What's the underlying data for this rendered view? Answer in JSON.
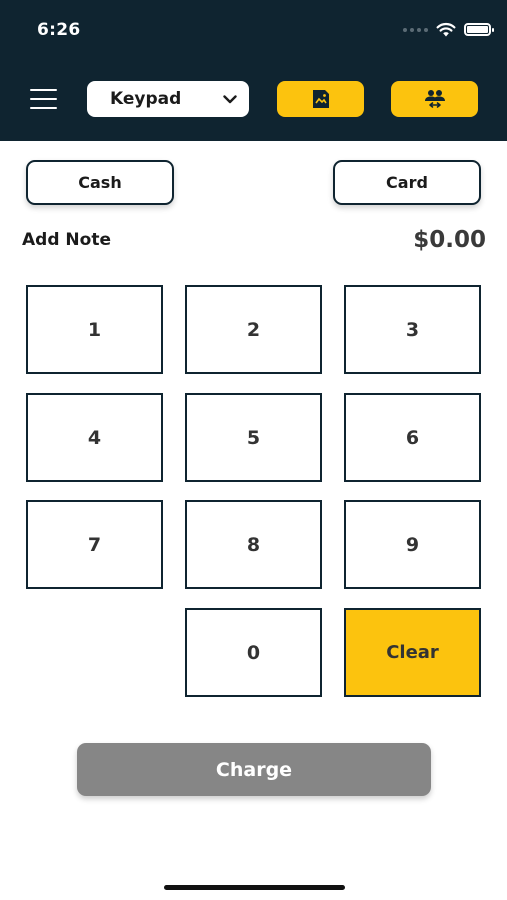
{
  "status_bar": {
    "time": "6:26"
  },
  "header": {
    "menu_icon": "hamburger-menu-icon",
    "mode_select": {
      "selected": "Keypad",
      "icon": "chevron-down-icon"
    },
    "action_buttons": [
      {
        "icon": "receipt-icon"
      },
      {
        "icon": "customers-icon"
      }
    ],
    "accent_color": "#fcc30e",
    "bar_color": "#0f2430"
  },
  "payment_types": {
    "cash": "Cash",
    "card": "Card"
  },
  "note": {
    "label": "Add Note"
  },
  "total": {
    "amount": "$0.00"
  },
  "keypad": {
    "keys": [
      "1",
      "2",
      "3",
      "4",
      "5",
      "6",
      "7",
      "8",
      "9",
      "0"
    ],
    "clear": "Clear"
  },
  "charge": {
    "label": "Charge",
    "color": "#868686"
  }
}
